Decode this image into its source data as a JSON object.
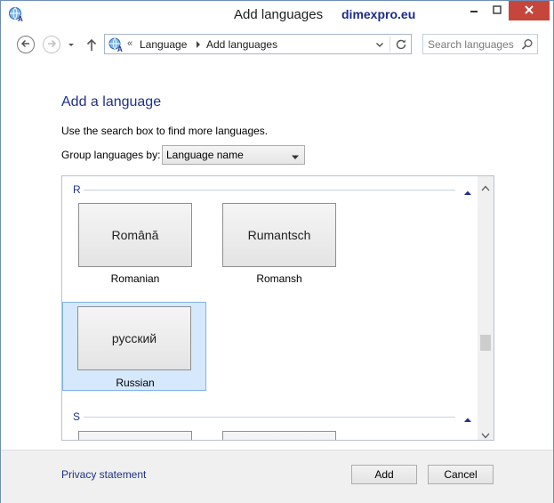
{
  "window": {
    "title": "Add languages",
    "watermark": "dimexpro.eu",
    "icons": {
      "app": "language-globe-icon",
      "minimize": "minimize-icon",
      "maximize": "maximize-icon",
      "close": "close-icon"
    }
  },
  "navbar": {
    "breadcrumb_overflow": "«",
    "crumbs": [
      "Language",
      "Add languages"
    ],
    "search": {
      "placeholder": "Search languages",
      "value": ""
    },
    "icons": {
      "back": "back-arrow-icon",
      "forward": "forward-arrow-icon",
      "recent": "chevron-down-icon",
      "up": "up-arrow-icon",
      "refresh": "refresh-icon",
      "search": "search-icon"
    }
  },
  "content": {
    "heading": "Add a language",
    "hint": "Use the search box to find more languages.",
    "group_by_label": "Group languages by:",
    "group_by_selected": "Language name",
    "groups": [
      {
        "letter": "R",
        "items": [
          {
            "native": "Română",
            "name": "Romanian",
            "selected": false
          },
          {
            "native": "Rumantsch",
            "name": "Romansh",
            "selected": false
          },
          {
            "native": "русский",
            "name": "Russian",
            "selected": true
          }
        ]
      },
      {
        "letter": "S",
        "items": []
      }
    ],
    "scrollbar_position": 0.66
  },
  "footer": {
    "privacy_link": "Privacy statement",
    "add_button": "Add",
    "cancel_button": "Cancel"
  },
  "colors": {
    "accent": "#1e3287",
    "selection_bg": "#d6e8fb",
    "selection_border": "#7fb2ea",
    "close_button": "#c7463b"
  }
}
